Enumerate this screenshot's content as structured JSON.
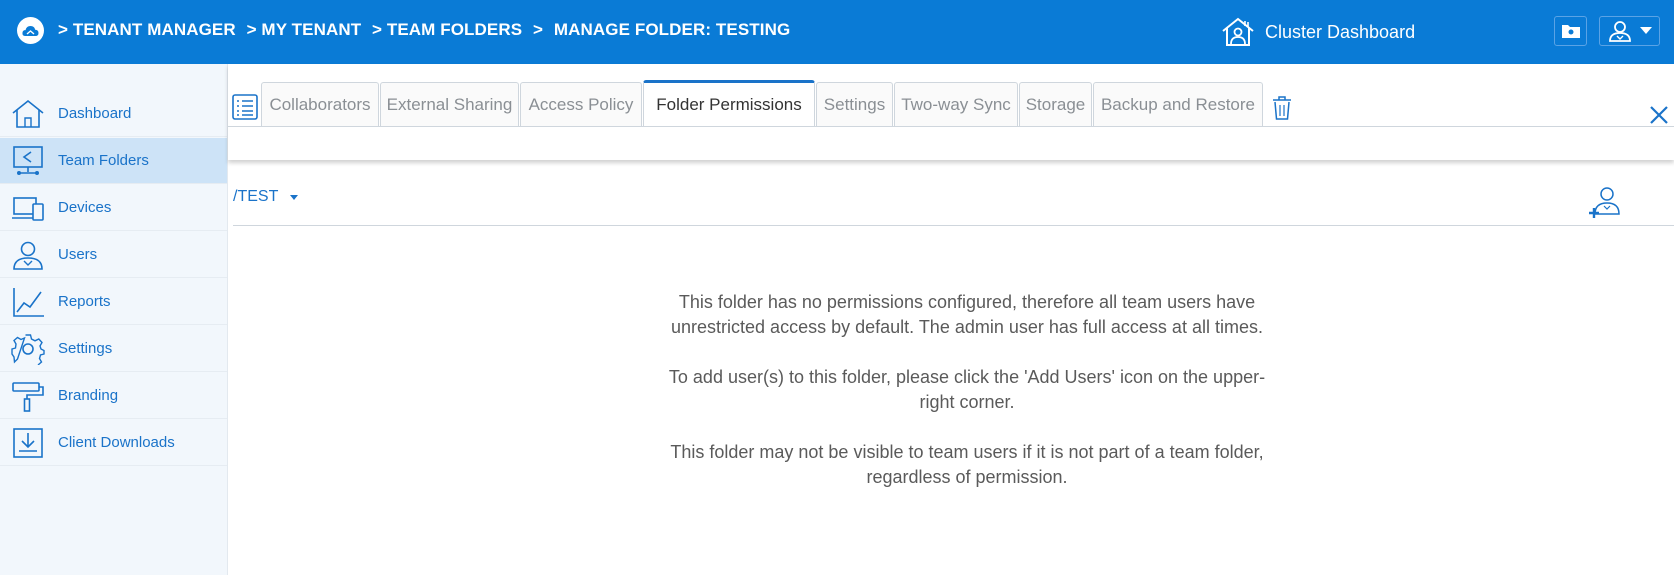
{
  "header": {
    "breadcrumb": [
      "> TENANT MANAGER",
      "> MY TENANT",
      "> TEAM FOLDERS",
      ">",
      "MANAGE FOLDER: TESTING"
    ],
    "cluster_label": "Cluster Dashboard",
    "brand_color": "#0a7bd6"
  },
  "sidebar": {
    "items": [
      {
        "label": "Dashboard",
        "icon": "home-icon"
      },
      {
        "label": "Team Folders",
        "icon": "team-folders-icon",
        "active": true
      },
      {
        "label": "Devices",
        "icon": "devices-icon"
      },
      {
        "label": "Users",
        "icon": "users-icon"
      },
      {
        "label": "Reports",
        "icon": "reports-icon"
      },
      {
        "label": "Settings",
        "icon": "gear-icon"
      },
      {
        "label": "Branding",
        "icon": "paint-roller-icon"
      },
      {
        "label": "Client Downloads",
        "icon": "download-icon"
      }
    ]
  },
  "tabs": {
    "items": [
      "Collaborators",
      "External Sharing",
      "Access Policy",
      "Folder Permissions",
      "Settings",
      "Two-way Sync",
      "Storage",
      "Backup and Restore"
    ],
    "active": "Folder Permissions"
  },
  "path": {
    "current": "/TEST"
  },
  "message": {
    "p1": "This folder has no permissions configured, therefore all team users have unrestricted access by default. The admin user has full access at all times.",
    "p2": "To add user(s) to this folder, please click the 'Add Users' icon on the upper-right corner.",
    "p3": "This folder may not be visible to team users if it is not part of a team folder, regardless of permission."
  }
}
